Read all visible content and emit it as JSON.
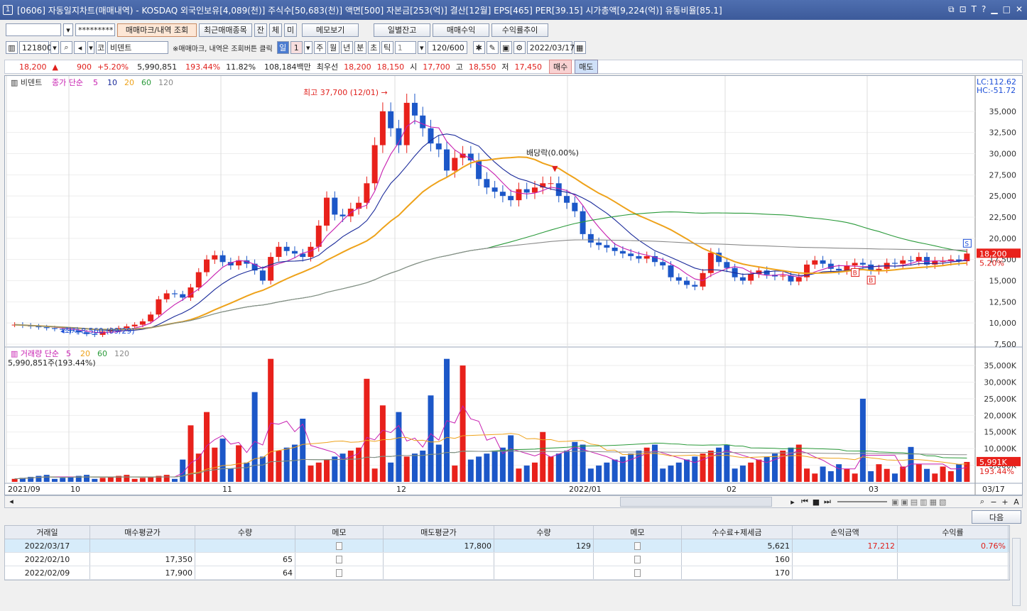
{
  "window": {
    "title": "[0606] 자동일지차트(매매내역) - KOSDAQ 외국인보유[4,089(천)] 주식수[50,683(천)] 액면[500] 자본금[253(억)] 결산[12월] EPS[465] PER[39.15] 시가총액[9,224(억)] 유통비율[85.1]",
    "number": "1"
  },
  "toolbar1": {
    "password": "*********",
    "buttons": [
      "매매마크/내역 조회",
      "최근매매종목",
      "잔",
      "체",
      "미",
      "메모보기",
      "일별잔고",
      "매매수익",
      "수익률추이"
    ]
  },
  "toolbar2": {
    "code": "121800",
    "market": "코",
    "name": "비덴트",
    "hint": "※매매마크, 내역은 조회버튼 클릭",
    "periods": [
      "일",
      "1",
      "주",
      "월",
      "년",
      "분",
      "초",
      "틱"
    ],
    "tick_val": "1",
    "count": "120/600",
    "date": "2022/03/17"
  },
  "quote": {
    "price": "18,200",
    "arrow": "▲",
    "change": "900",
    "pct": "+5.20%",
    "volume": "5,990,851",
    "vol_ratio": "193.44%",
    "turnover": "11.82%",
    "amount": "108,184백만",
    "best_label": "최우선",
    "best_ask": "18,200",
    "best_bid": "18,150",
    "open_label": "시",
    "open": "17,700",
    "high_label": "고",
    "high": "18,550",
    "low_label": "저",
    "low": "17,450",
    "buy": "매수",
    "sell": "매도"
  },
  "chart": {
    "legend_stock": "비덴트",
    "legend_ma": "종가 단순",
    "ma_periods": [
      "5",
      "10",
      "20",
      "60",
      "120"
    ],
    "legend_vol": "거래량 단순",
    "vol_periods": [
      "5",
      "20",
      "60",
      "120"
    ],
    "vol_info": "5,990,851주(193.44%)",
    "lc": "LC:112.62",
    "hc": "HC:-51.72",
    "high_note": "최고 37,700 (12/01)",
    "low_note": "최저 8,560 (09/29)",
    "div_note": "배당락(0.00%)",
    "last_price": "18,200",
    "last_pct": "5.20%",
    "last_vol": "5,991K",
    "last_vol_pct": "193.44%",
    "price_ticks": [
      "35,000",
      "32,500",
      "30,000",
      "27,500",
      "25,000",
      "22,500",
      "20,000",
      "17,500",
      "15,000",
      "12,500",
      "10,000",
      "7,500"
    ],
    "vol_ticks": [
      "35,000K",
      "30,000K",
      "25,000K",
      "20,000K",
      "15,000K",
      "10,000K",
      "5,000K"
    ],
    "date_labels": [
      "2021/09",
      "10",
      "11",
      "12",
      "2022/01",
      "02",
      "03",
      "03/17"
    ],
    "colors": {
      "up": "#e8211b",
      "down": "#1c57c8",
      "ma5": "#c71fb0",
      "ma10": "#1a2a9a",
      "ma20": "#eea21a",
      "ma60": "#2a9a3a",
      "ma120": "#8a8a8a"
    }
  },
  "table": {
    "next": "다음",
    "headers": [
      "거래일",
      "매수평균가",
      "수량",
      "메모",
      "매도평균가",
      "수량",
      "메모",
      "수수료+제세금",
      "손익금액",
      "수익률"
    ],
    "rows": [
      [
        "2022/03/17",
        "",
        "",
        "",
        "17,800",
        "129",
        "",
        "5,621",
        "17,212",
        "0.76%"
      ],
      [
        "2022/02/10",
        "17,350",
        "65",
        "",
        "",
        "",
        "",
        "160",
        "",
        ""
      ],
      [
        "2022/02/09",
        "17,900",
        "64",
        "",
        "",
        "",
        "",
        "170",
        "",
        ""
      ]
    ]
  }
}
